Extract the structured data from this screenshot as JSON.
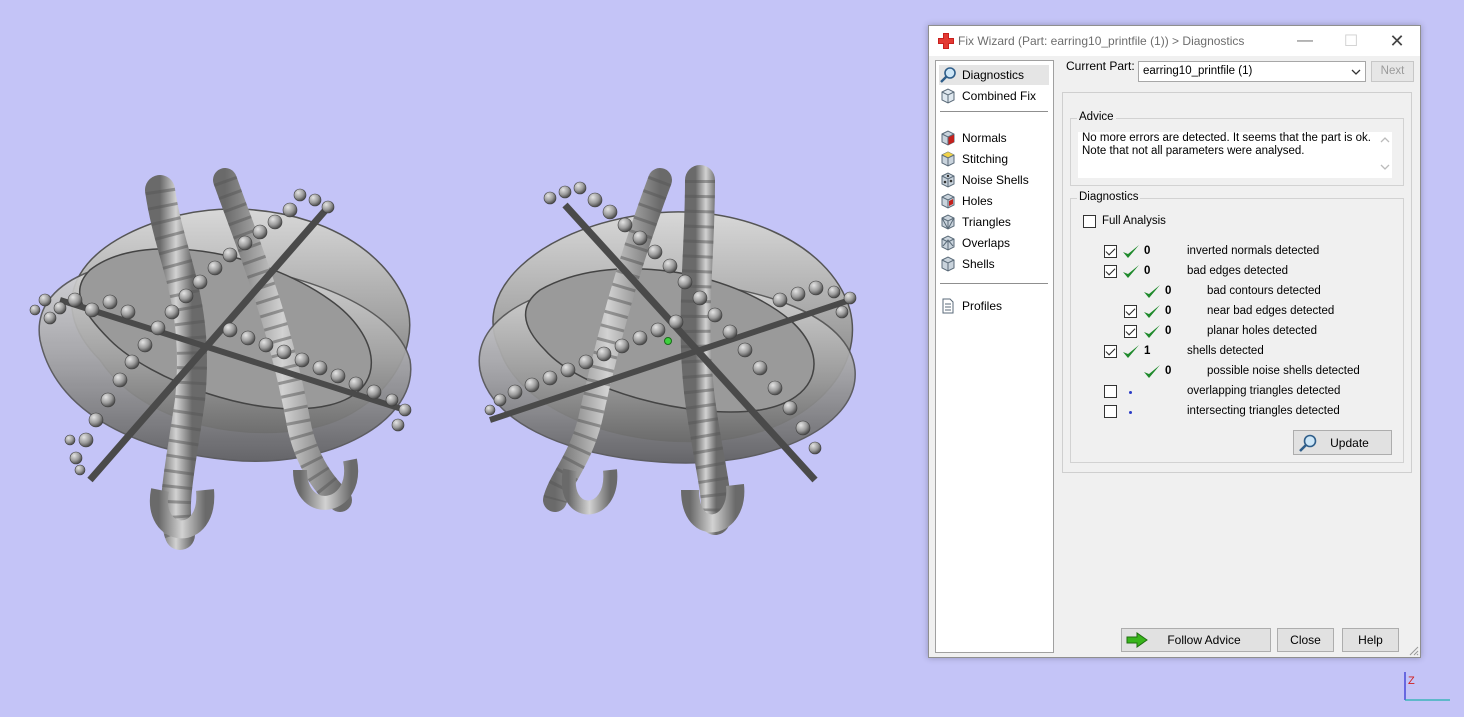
{
  "window": {
    "title": "Fix Wizard (Part: earring10_printfile (1)) > Diagnostics",
    "minimize_glyph": "—",
    "maximize_glyph": "☐",
    "close_glyph": "✕"
  },
  "nav": {
    "items": [
      {
        "label": "Diagnostics",
        "icon": "magnifier-icon",
        "selected": true
      },
      {
        "label": "Combined Fix",
        "icon": "combined-fix-icon"
      },
      {
        "label": "Normals",
        "icon": "normals-cube-icon"
      },
      {
        "label": "Stitching",
        "icon": "stitching-cube-icon"
      },
      {
        "label": "Noise Shells",
        "icon": "noise-shells-cube-icon"
      },
      {
        "label": "Holes",
        "icon": "holes-cube-icon"
      },
      {
        "label": "Triangles",
        "icon": "triangles-cube-icon"
      },
      {
        "label": "Overlaps",
        "icon": "overlaps-cube-icon"
      },
      {
        "label": "Shells",
        "icon": "shells-cube-icon"
      },
      {
        "label": "Profiles",
        "icon": "profiles-page-icon"
      }
    ]
  },
  "header": {
    "current_part_label": "Current Part:",
    "current_part_value": "earring10_printfile (1)",
    "next_label": "Next"
  },
  "advice": {
    "legend": "Advice",
    "line1": "No more errors are detected. It seems that the part is ok.",
    "line2": "Note that not all parameters were analysed."
  },
  "diagnostics": {
    "legend": "Diagnostics",
    "full_analysis_label": "Full Analysis",
    "full_analysis_checked": false,
    "rows": [
      {
        "label": "inverted normals detected",
        "value": "0",
        "checked": true
      },
      {
        "label": "bad edges detected",
        "value": "0",
        "checked": true
      },
      {
        "label": "bad contours detected",
        "value": "0"
      },
      {
        "label": "near bad edges detected",
        "value": "0",
        "checked": true
      },
      {
        "label": "planar holes detected",
        "value": "0",
        "checked": true
      },
      {
        "label": "shells detected",
        "value": "1",
        "checked": true
      },
      {
        "label": "possible noise shells detected",
        "value": "0"
      },
      {
        "label": "overlapping triangles detected",
        "checked": false
      },
      {
        "label": "intersecting triangles detected",
        "checked": false
      }
    ],
    "update_label": "Update"
  },
  "footer": {
    "follow_advice_label": "Follow Advice",
    "close_label": "Close",
    "help_label": "Help"
  },
  "axis": {
    "z_label": "Z"
  },
  "colors": {
    "background": "#c4c4f7",
    "check_green": "#1f8a2c",
    "arrow_green": "#38b51b",
    "window_bg": "#f0f0f0"
  }
}
